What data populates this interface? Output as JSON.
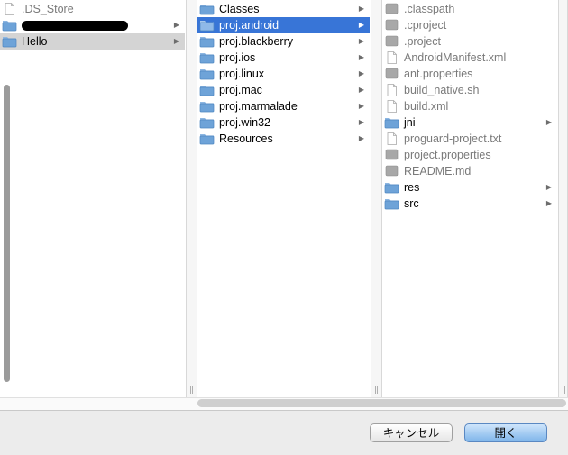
{
  "columns": [
    {
      "items": [
        {
          "label": ".DS_Store",
          "type": "file",
          "dim": true,
          "arrow": false
        },
        {
          "label": "",
          "type": "folder",
          "redacted": true,
          "arrow": true
        },
        {
          "label": "Hello",
          "type": "folder",
          "arrow": true,
          "selected": "gray"
        }
      ]
    },
    {
      "items": [
        {
          "label": "Classes",
          "type": "folder",
          "arrow": true
        },
        {
          "label": "proj.android",
          "type": "folder",
          "arrow": true,
          "selected": "blue"
        },
        {
          "label": "proj.blackberry",
          "type": "folder",
          "arrow": true
        },
        {
          "label": "proj.ios",
          "type": "folder",
          "arrow": true
        },
        {
          "label": "proj.linux",
          "type": "folder",
          "arrow": true
        },
        {
          "label": "proj.mac",
          "type": "folder",
          "arrow": true
        },
        {
          "label": "proj.marmalade",
          "type": "folder",
          "arrow": true
        },
        {
          "label": "proj.win32",
          "type": "folder",
          "arrow": true
        },
        {
          "label": "Resources",
          "type": "folder",
          "arrow": true
        }
      ]
    },
    {
      "items": [
        {
          "label": ".classpath",
          "type": "file-gray",
          "dim": true
        },
        {
          "label": ".cproject",
          "type": "file-gray",
          "dim": true
        },
        {
          "label": ".project",
          "type": "file-gray",
          "dim": true
        },
        {
          "label": "AndroidManifest.xml",
          "type": "file",
          "dim": true
        },
        {
          "label": "ant.properties",
          "type": "file-gray",
          "dim": true
        },
        {
          "label": "build_native.sh",
          "type": "file",
          "dim": true
        },
        {
          "label": "build.xml",
          "type": "file",
          "dim": true
        },
        {
          "label": "jni",
          "type": "folder",
          "arrow": true
        },
        {
          "label": "proguard-project.txt",
          "type": "file",
          "dim": true
        },
        {
          "label": "project.properties",
          "type": "file-gray",
          "dim": true
        },
        {
          "label": "README.md",
          "type": "file-gray",
          "dim": true
        },
        {
          "label": "res",
          "type": "folder",
          "arrow": true
        },
        {
          "label": "src",
          "type": "folder",
          "arrow": true
        }
      ]
    }
  ],
  "buttons": {
    "cancel_label": "キャンセル",
    "open_label": "開く"
  },
  "icons": {
    "folder": "folder-icon",
    "file": "document-icon",
    "file-gray": "generic-file-icon",
    "arrow": "disclosure-arrow-icon",
    "grip": "column-resize-grip-icon"
  },
  "colors": {
    "selection_blue": "#3875d7",
    "selection_gray": "#d4d4d4",
    "folder_blue": "#6ea3d8"
  }
}
